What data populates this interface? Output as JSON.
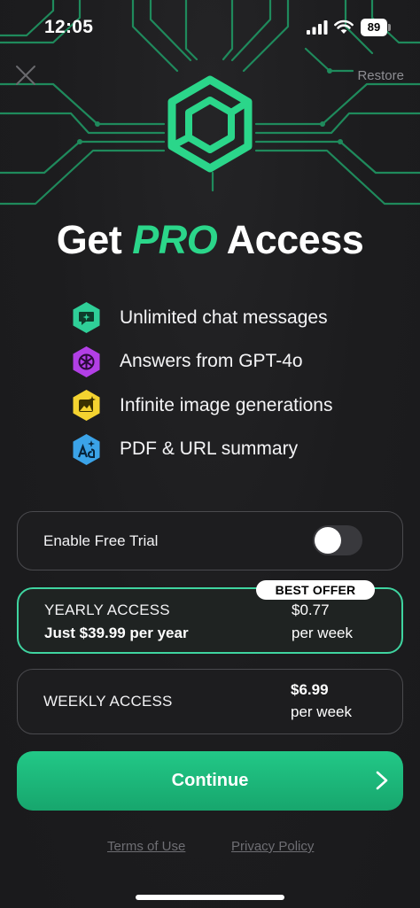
{
  "status_bar": {
    "time": "12:05",
    "battery": "89"
  },
  "header": {
    "restore_label": "Restore",
    "title_prefix": "Get",
    "title_highlight": "PRO",
    "title_suffix": "Access"
  },
  "features": [
    {
      "label": "Unlimited chat messages",
      "icon": "chat-sparkle-icon",
      "color": "#2fcf98"
    },
    {
      "label": "Answers from GPT-4o",
      "icon": "openai-icon",
      "color": "#b23fe6"
    },
    {
      "label": "Infinite image generations",
      "icon": "image-sparkle-icon",
      "color": "#f4d330"
    },
    {
      "label": "PDF & URL summary",
      "icon": "text-sparkle-icon",
      "color": "#3ba3e8"
    }
  ],
  "trial": {
    "label": "Enable Free Trial",
    "enabled": false
  },
  "plans": {
    "yearly": {
      "badge": "BEST OFFER",
      "name": "YEARLY ACCESS",
      "subtitle": "Just $39.99 per year",
      "price": "$0.77",
      "per": "per week"
    },
    "weekly": {
      "name": "WEEKLY ACCESS",
      "price": "$6.99",
      "per": "per week"
    }
  },
  "continue_label": "Continue",
  "footer": {
    "terms": "Terms of Use",
    "privacy": "Privacy Policy"
  },
  "colors": {
    "accent": "#2bd68a",
    "background": "#1c1c1e",
    "card_border": "#4a4a4e",
    "selected_border": "#3fd4a0"
  }
}
